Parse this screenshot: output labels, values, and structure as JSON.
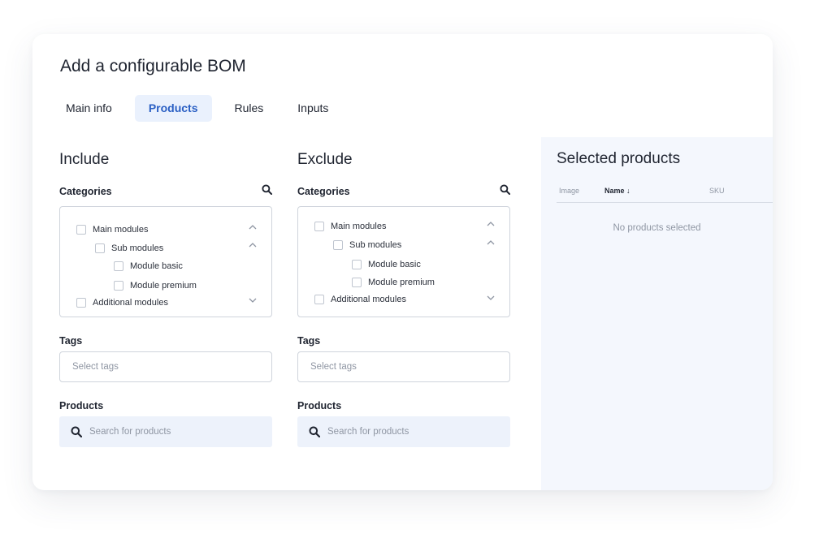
{
  "title": "Add a configurable BOM",
  "tabs": [
    {
      "label": "Main info",
      "active": false
    },
    {
      "label": "Products",
      "active": true
    },
    {
      "label": "Rules",
      "active": false
    },
    {
      "label": "Inputs",
      "active": false
    }
  ],
  "include": {
    "title": "Include",
    "categories_label": "Categories",
    "tree": [
      "Main modules",
      "Sub modules",
      "Module basic",
      "Module premium",
      "Additional modules"
    ],
    "tags_label": "Tags",
    "tags_placeholder": "Select tags",
    "products_label": "Products",
    "products_placeholder": "Search for products"
  },
  "exclude": {
    "title": "Exclude",
    "categories_label": "Categories",
    "tree": [
      "Main modules",
      "Sub modules",
      "Module basic",
      "Module premium",
      "Additional modules"
    ],
    "tags_label": "Tags",
    "tags_placeholder": "Select tags",
    "products_label": "Products",
    "products_placeholder": "Search for products"
  },
  "selected": {
    "title": "Selected products",
    "columns": [
      "Image",
      "Name ↓",
      "SKU"
    ],
    "empty_text": "No products selected"
  },
  "colors": {
    "accent": "#2a5fc4",
    "active_tab_bg": "#eaf1fd",
    "panel_bg": "#f4f7fd"
  },
  "icons": [
    "search-icon",
    "chevron-up-icon",
    "chevron-down-icon",
    "checkbox-icon",
    "sort-down-icon"
  ]
}
